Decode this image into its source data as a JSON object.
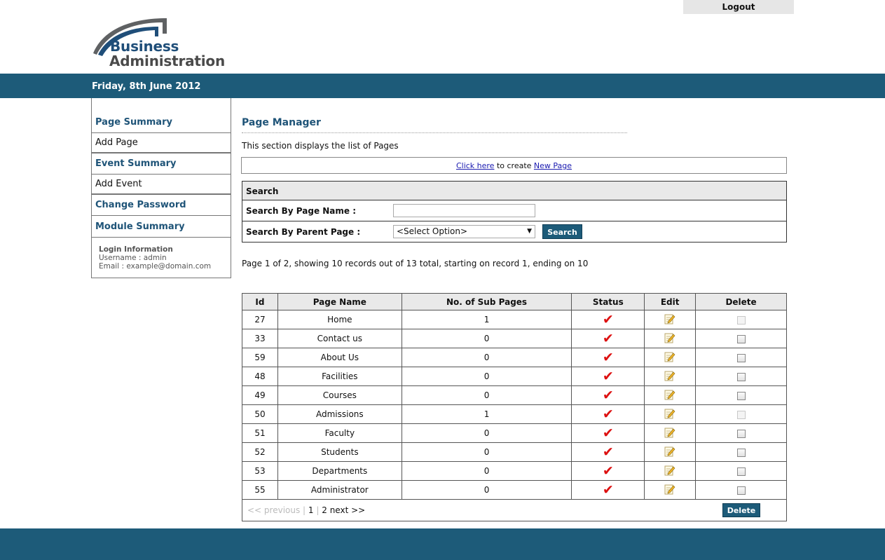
{
  "header": {
    "logout_label": "Logout",
    "logo_line1": "Business",
    "logo_line2": "Administration",
    "date": "Friday, 8th June 2012"
  },
  "sidebar": {
    "items": [
      {
        "label": "Page Summary",
        "kind": "heading"
      },
      {
        "label": "Add Page",
        "kind": "link"
      },
      {
        "label": "Event Summary",
        "kind": "heading"
      },
      {
        "label": "Add Event",
        "kind": "link"
      },
      {
        "label": "Change Password",
        "kind": "heading"
      },
      {
        "label": "Module Summary",
        "kind": "heading"
      }
    ],
    "login": {
      "title": "Login Information",
      "username": "Username : admin",
      "email": "Email : example@domain.com"
    }
  },
  "main": {
    "title": "Page Manager",
    "description": "This section displays the list of Pages",
    "create": {
      "link1": "Click here",
      "middle": " to create ",
      "link2": "New Page"
    },
    "search": {
      "heading": "Search",
      "name_label": "Search By Page Name :",
      "name_value": "",
      "parent_label": "Search By Parent Page :",
      "parent_selected": "<Select Option>",
      "button": "Search"
    },
    "paging_info": "Page 1 of 2, showing 10 records out of 13 total, starting on record 1, ending on 10",
    "table": {
      "columns": [
        "Id",
        "Page Name",
        "No. of Sub Pages",
        "Status",
        "Edit",
        "Delete"
      ],
      "rows": [
        {
          "id": "27",
          "name": "Home",
          "subpages": "1",
          "delete_enabled": false
        },
        {
          "id": "33",
          "name": "Contact us",
          "subpages": "0",
          "delete_enabled": true
        },
        {
          "id": "59",
          "name": "About Us",
          "subpages": "0",
          "delete_enabled": true
        },
        {
          "id": "48",
          "name": "Facilities",
          "subpages": "0",
          "delete_enabled": true
        },
        {
          "id": "49",
          "name": "Courses",
          "subpages": "0",
          "delete_enabled": true
        },
        {
          "id": "50",
          "name": "Admissions",
          "subpages": "1",
          "delete_enabled": false
        },
        {
          "id": "51",
          "name": "Faculty",
          "subpages": "0",
          "delete_enabled": true
        },
        {
          "id": "52",
          "name": "Students",
          "subpages": "0",
          "delete_enabled": true
        },
        {
          "id": "53",
          "name": "Departments",
          "subpages": "0",
          "delete_enabled": true
        },
        {
          "id": "55",
          "name": "Administrator",
          "subpages": "0",
          "delete_enabled": true
        }
      ],
      "status_icon": "check-icon",
      "status_color": "#dd1111",
      "edit_icon": "edit-icon"
    },
    "pager": {
      "previous": "<< previous",
      "sep": " | ",
      "page1": "1",
      "page2": "2",
      "next": "next >>"
    },
    "delete_button": "Delete"
  },
  "colors": {
    "brand": "#1d5b79",
    "heading": "#1f5478"
  }
}
